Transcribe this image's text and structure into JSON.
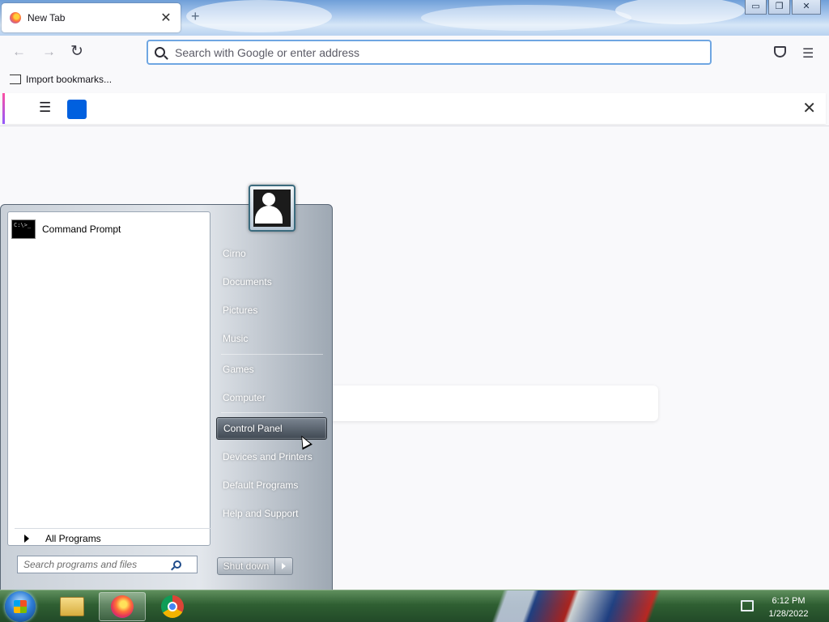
{
  "browser": {
    "tab": {
      "title": "New Tab",
      "close_glyph": "✕"
    },
    "new_tab_glyph": "+",
    "window_controls": {
      "minimize": "▭",
      "restore": "❐",
      "close": "✕"
    },
    "nav": {
      "back_glyph": "←",
      "forward_glyph": "→",
      "reload_glyph": "↻"
    },
    "address_bar": {
      "placeholder": "Search with Google or enter address",
      "value": ""
    },
    "menu_glyph": "☰",
    "bookmarks_toolbar": {
      "import_label": "Import bookmarks..."
    },
    "notification_bar": {
      "menu_glyph": "☰",
      "close_glyph": "✕"
    }
  },
  "start_menu": {
    "pinned": [
      {
        "label": "Command Prompt",
        "icon": "cmd-icon",
        "icon_text": "C:\\>_"
      }
    ],
    "all_programs_label": "All Programs",
    "search_placeholder": "Search programs and files",
    "user_name": "Cirno",
    "right_items": [
      {
        "label": "Cirno"
      },
      {
        "label": "Documents"
      },
      {
        "label": "Pictures"
      },
      {
        "label": "Music"
      },
      {
        "label": "Games"
      },
      {
        "label": "Computer"
      },
      {
        "label": "Control Panel",
        "highlighted": true
      },
      {
        "label": "Devices and Printers"
      },
      {
        "label": "Default Programs"
      },
      {
        "label": "Help and Support"
      }
    ],
    "shutdown_label": "Shut down"
  },
  "taskbar": {
    "pinned": [
      {
        "name": "windows-explorer",
        "icon": "folder-icon"
      },
      {
        "name": "firefox",
        "icon": "firefox-icon",
        "active": true
      },
      {
        "name": "chrome",
        "icon": "chrome-icon"
      }
    ],
    "clock": {
      "time": "6:12 PM",
      "date": "1/28/2022"
    }
  },
  "colors": {
    "accent": "#0060df",
    "url_focus": "#6fa6e2",
    "taskbar": "#2f5f32"
  }
}
